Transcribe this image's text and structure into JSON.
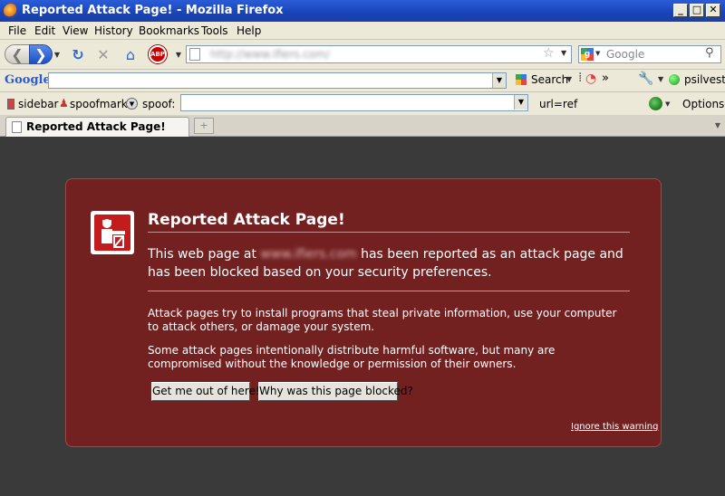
{
  "window": {
    "title": "Reported Attack Page! - Mozilla Firefox"
  },
  "menubar": [
    "File",
    "Edit",
    "View",
    "History",
    "Bookmarks",
    "Tools",
    "Help"
  ],
  "navbar": {
    "url_value": "http://www.ifiers.com/",
    "search_placeholder": "Google",
    "abp_label": "ABP"
  },
  "googlebar": {
    "logo": "Google",
    "search_label": "Search",
    "user_label": "psilvest-"
  },
  "spoofbar": {
    "sidebar_label": "sidebar",
    "spoofmark_label": "spoofmark",
    "spoof_label": "spoof:",
    "urlref_label": "url=ref",
    "options_label": "Options-"
  },
  "tab": {
    "title": "Reported Attack Page!"
  },
  "warning": {
    "title": "Reported Attack Page!",
    "para1_before": "This web page at ",
    "para1_site": "www.ifiers.com",
    "para1_after": " has been reported as an attack page and has been blocked based on your security preferences.",
    "para2": "Attack pages try to install programs that steal private information, use your computer to attack others, or damage your system.",
    "para3": "Some attack pages intentionally distribute harmful software, but many are compromised without the knowledge or permission of their owners.",
    "btn_getout": "Get me out of here!",
    "btn_why": "Why was this page blocked?",
    "ignore": "Ignore this warning"
  },
  "colors": {
    "panel": "#722020",
    "background": "#3a3a3a",
    "titlebar": "#1844b8"
  }
}
